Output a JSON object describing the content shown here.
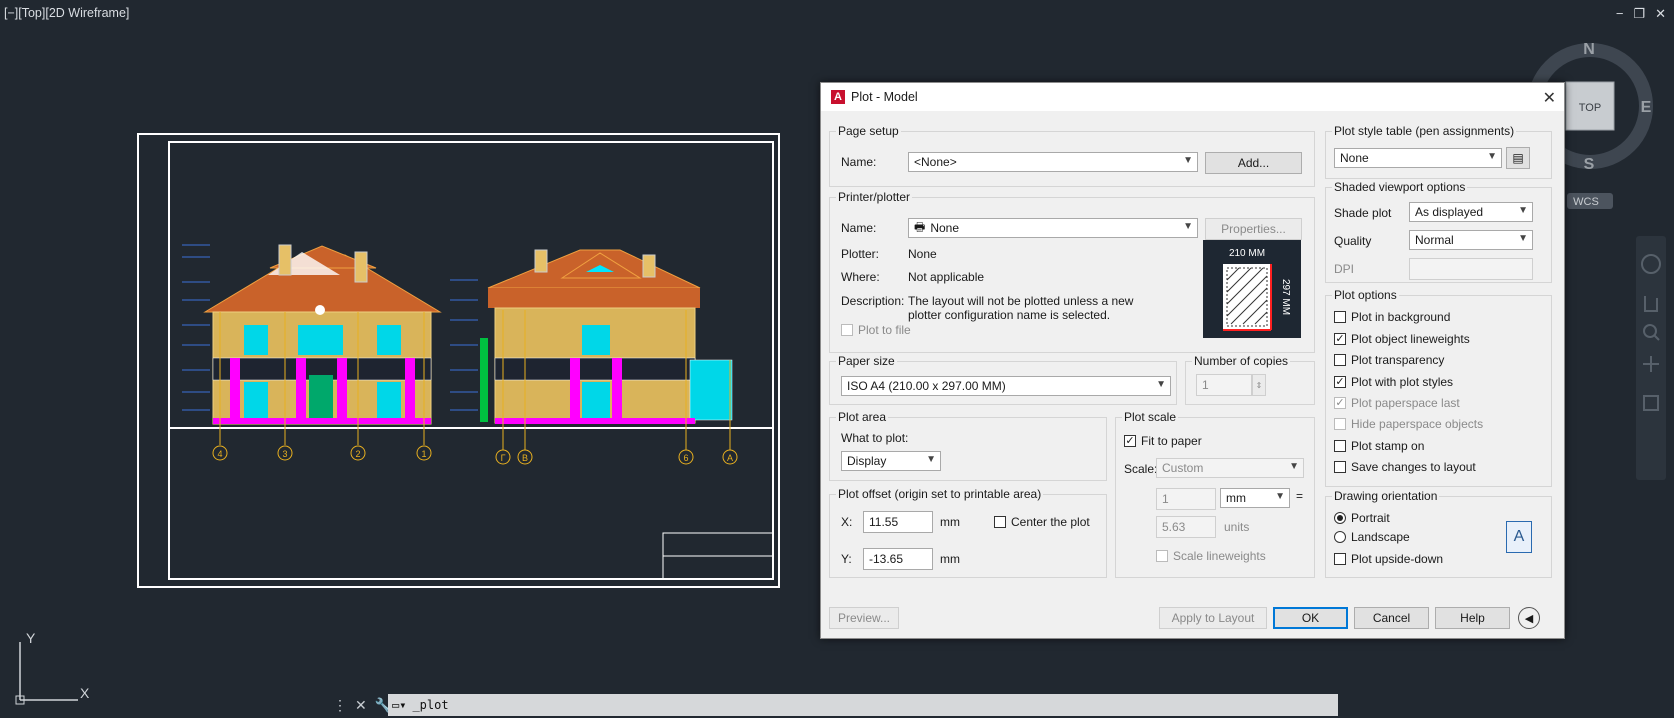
{
  "viewport": {
    "label": "[−][Top][2D Wireframe]"
  },
  "window_buttons": {
    "minimize": "−",
    "restore": "❐",
    "close": "✕"
  },
  "viewcube": {
    "north": "N",
    "south": "S",
    "east": "E",
    "top": "TOP",
    "wcs": "WCS"
  },
  "ucs": {
    "x": "X",
    "y": "Y"
  },
  "drawing": {
    "grid_labels_left": [
      "4",
      "3",
      "2",
      "1"
    ],
    "grid_labels_right": [
      "Г",
      "B",
      "6",
      "A"
    ]
  },
  "command_line": {
    "text": "_plot"
  },
  "dialog": {
    "title": "Plot - Model",
    "page_setup": {
      "title": "Page setup",
      "name_label": "Name:",
      "name_value": "<None>",
      "add_button": "Add..."
    },
    "printer": {
      "title": "Printer/plotter",
      "name_label": "Name:",
      "name_value": "None",
      "properties_button": "Properties...",
      "plotter_label": "Plotter:",
      "plotter_value": "None",
      "where_label": "Where:",
      "where_value": "Not applicable",
      "description_label": "Description:",
      "description_value": "The layout will not be plotted unless a new plotter configuration name is selected.",
      "plot_to_file": "Plot to file",
      "preview_width": "210 MM",
      "preview_height": "297 MM"
    },
    "paper_size": {
      "title": "Paper size",
      "value": "ISO A4 (210.00 x 297.00 MM)"
    },
    "copies": {
      "title": "Number of copies",
      "value": "1"
    },
    "plot_area": {
      "title": "Plot area",
      "what_label": "What to plot:",
      "value": "Display"
    },
    "plot_offset": {
      "title": "Plot offset (origin set to printable area)",
      "x_label": "X:",
      "x_value": "11.55",
      "x_unit": "mm",
      "y_label": "Y:",
      "y_value": "-13.65",
      "y_unit": "mm",
      "center": "Center the plot"
    },
    "plot_scale": {
      "title": "Plot scale",
      "fit": "Fit to paper",
      "scale_label": "Scale:",
      "scale_value": "Custom",
      "num": "1",
      "unit": "mm",
      "eq": "=",
      "den": "5.63",
      "den_unit": "units",
      "lineweights": "Scale lineweights"
    },
    "style_table": {
      "title": "Plot style table (pen assignments)",
      "value": "None"
    },
    "shaded": {
      "title": "Shaded viewport options",
      "shade_label": "Shade plot",
      "shade_value": "As displayed",
      "quality_label": "Quality",
      "quality_value": "Normal",
      "dpi_label": "DPI"
    },
    "options": {
      "title": "Plot options",
      "items": [
        {
          "label": "Plot in background",
          "checked": false,
          "disabled": false
        },
        {
          "label": "Plot object lineweights",
          "checked": true,
          "disabled": false
        },
        {
          "label": "Plot transparency",
          "checked": false,
          "disabled": false
        },
        {
          "label": "Plot with plot styles",
          "checked": true,
          "disabled": false
        },
        {
          "label": "Plot paperspace last",
          "checked": true,
          "disabled": true
        },
        {
          "label": "Hide paperspace objects",
          "checked": false,
          "disabled": true
        },
        {
          "label": "Plot stamp on",
          "checked": false,
          "disabled": false
        },
        {
          "label": "Save changes to layout",
          "checked": false,
          "disabled": false
        }
      ]
    },
    "orientation": {
      "title": "Drawing orientation",
      "portrait": "Portrait",
      "landscape": "Landscape",
      "upside": "Plot upside-down",
      "icon_letter": "A"
    },
    "buttons": {
      "preview": "Preview...",
      "apply": "Apply to Layout",
      "ok": "OK",
      "cancel": "Cancel",
      "help": "Help"
    }
  },
  "colors": {
    "background": "#212830",
    "drawing_frame": "#ffffff",
    "roof": "#d2691e",
    "wall": "#e6c067",
    "accent_magenta": "#ff00ff",
    "accent_cyan": "#00e5ff"
  }
}
